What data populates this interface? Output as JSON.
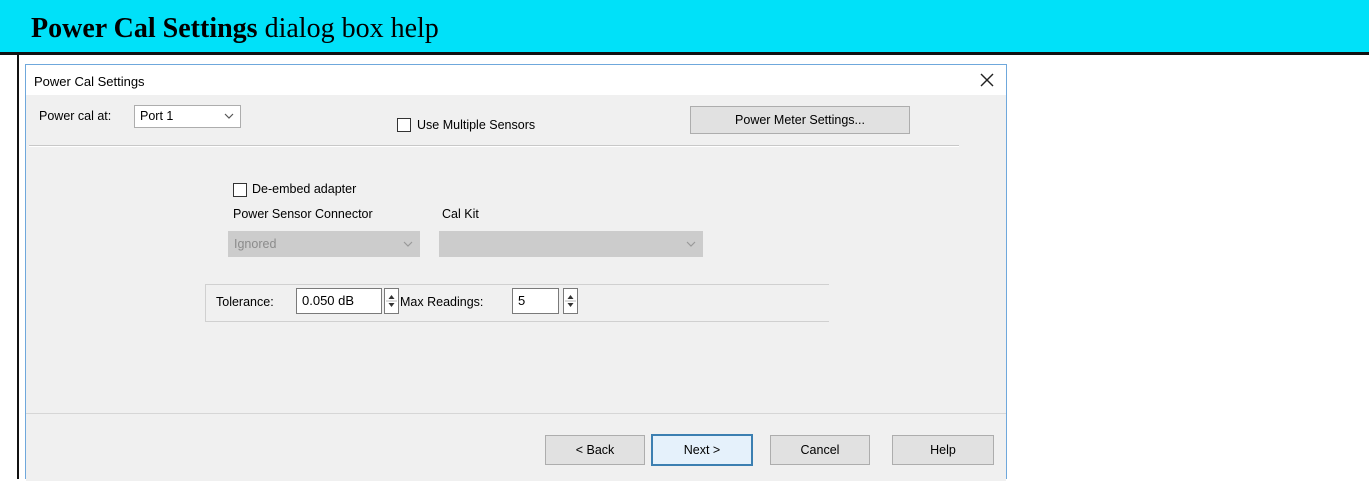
{
  "help": {
    "title_bold": "Power Cal Settings",
    "title_rest": " dialog box help"
  },
  "dialog": {
    "title": "Power Cal Settings",
    "power_cal_at_label": "Power cal at:",
    "power_cal_at_value": "Port 1",
    "use_multiple_sensors_label": "Use Multiple Sensors",
    "use_multiple_sensors_checked": false,
    "power_meter_settings_label": "Power Meter Settings...",
    "de_embed_label": "De-embed adapter",
    "de_embed_checked": false,
    "power_sensor_connector_label": "Power Sensor Connector",
    "power_sensor_connector_value": "Ignored",
    "cal_kit_label": "Cal Kit",
    "cal_kit_value": "",
    "tolerance_label": "Tolerance:",
    "tolerance_value": "0.050 dB",
    "max_readings_label": "Max Readings:",
    "max_readings_value": "5",
    "buttons": {
      "back": "< Back",
      "next": "Next >",
      "cancel": "Cancel",
      "help": "Help"
    }
  },
  "icons": {
    "close": "close-icon",
    "dropdown": "chevron-down-icon",
    "spinner": "spinner-arrows-icon"
  },
  "colors": {
    "header_bg": "#00e1f9",
    "dialog_bg": "#f0f0f0",
    "primary_border": "#3c7fb1"
  }
}
